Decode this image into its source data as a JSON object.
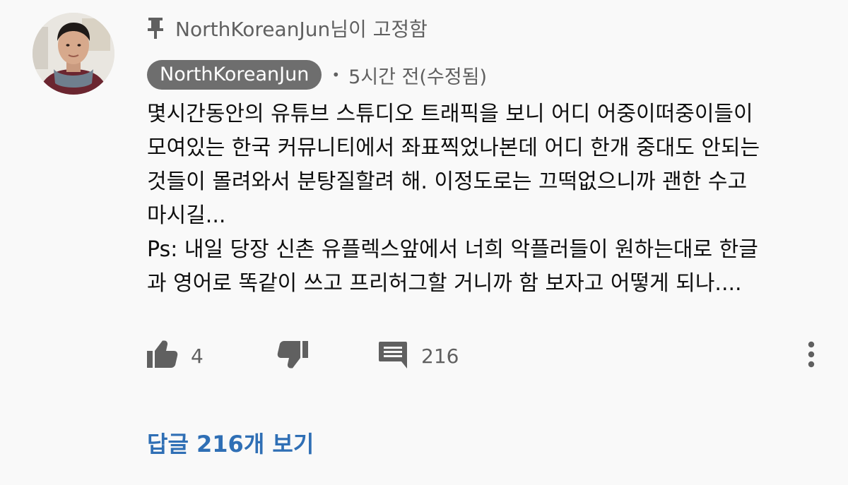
{
  "pinned": {
    "text": "NorthKoreanJun님이 고정함",
    "icon": "pin-icon"
  },
  "comment": {
    "author": "NorthKoreanJun",
    "separator": "•",
    "timestamp": "5시간 전(수정됨)",
    "lines": [
      "몇시간동안의 유튜브 스튜디오 트래픽을 보니 어디 어중이떠중이들이",
      "모여있는 한국 커뮤니티에서 좌표찍었나본데 어디 한개 중대도 안되는",
      "것들이 몰려와서 분탕질할려 해. 이정도로는 끄떡없으니까 괜한 수고",
      "마시길...",
      "Ps: 내일 당장 신촌 유플렉스앞에서 너희 악플러들이 원하는대로 한글",
      "과 영어로 똑같이 쓰고 프리허그할 거니까 함 보자고 어떻게 되나...."
    ]
  },
  "actions": {
    "like_count": "4",
    "reply_count": "216",
    "icons": [
      "thumbs-up-icon",
      "thumbs-down-icon",
      "comment-icon",
      "more-vert-icon"
    ]
  },
  "replies": {
    "view_label": "답글 216개 보기"
  },
  "colors": {
    "background": "#f9f9f9",
    "secondary_text": "#606060",
    "author_chip": "#6e6e6e",
    "link": "#2f6fb5"
  }
}
